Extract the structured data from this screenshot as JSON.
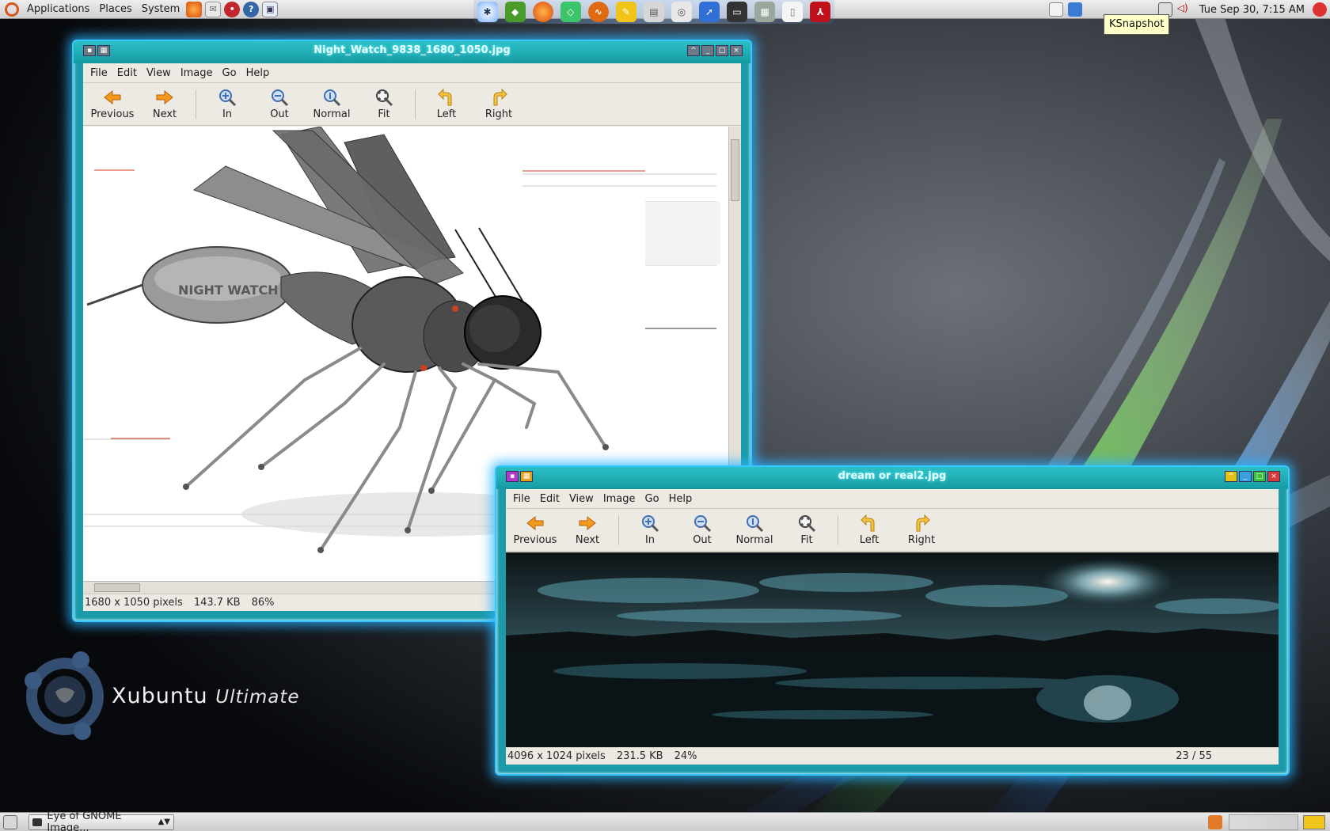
{
  "top_panel": {
    "menus": [
      "Applications",
      "Places",
      "System"
    ],
    "clock": "Tue Sep 30,  7:15 AM",
    "tooltip": "KSnapshot"
  },
  "windows": [
    {
      "title": "Night_Watch_9838_1680_1050.jpg",
      "menus": [
        "File",
        "Edit",
        "View",
        "Image",
        "Go",
        "Help"
      ],
      "toolbar": [
        "Previous",
        "Next",
        "In",
        "Out",
        "Normal",
        "Fit",
        "Left",
        "Right"
      ],
      "status": {
        "dimensions": "1680 x 1050 pixels",
        "size": "143.7 KB",
        "zoom": "86%"
      },
      "image_text": "NIGHT WATCH"
    },
    {
      "title": "dream or real2.jpg",
      "menus": [
        "File",
        "Edit",
        "View",
        "Image",
        "Go",
        "Help"
      ],
      "toolbar": [
        "Previous",
        "Next",
        "In",
        "Out",
        "Normal",
        "Fit",
        "Left",
        "Right"
      ],
      "status": {
        "dimensions": "4096 x 1024 pixels",
        "size": "231.5 KB",
        "zoom": "24%",
        "counter": "23 / 55"
      }
    }
  ],
  "brand": {
    "name": "Xubuntu",
    "edition": "Ultimate"
  },
  "taskbar": {
    "task_label": "Eye of GNOME Image..."
  },
  "colors": {
    "window_glow": "#37c7ff",
    "titlebar": "#1fa9b1",
    "panel": "#dedede"
  },
  "icons": {
    "toolbar": [
      "arrow-left-icon",
      "arrow-right-icon",
      "zoom-in-icon",
      "zoom-out-icon",
      "zoom-normal-icon",
      "zoom-fit-icon",
      "rotate-left-icon",
      "rotate-right-icon"
    ]
  }
}
